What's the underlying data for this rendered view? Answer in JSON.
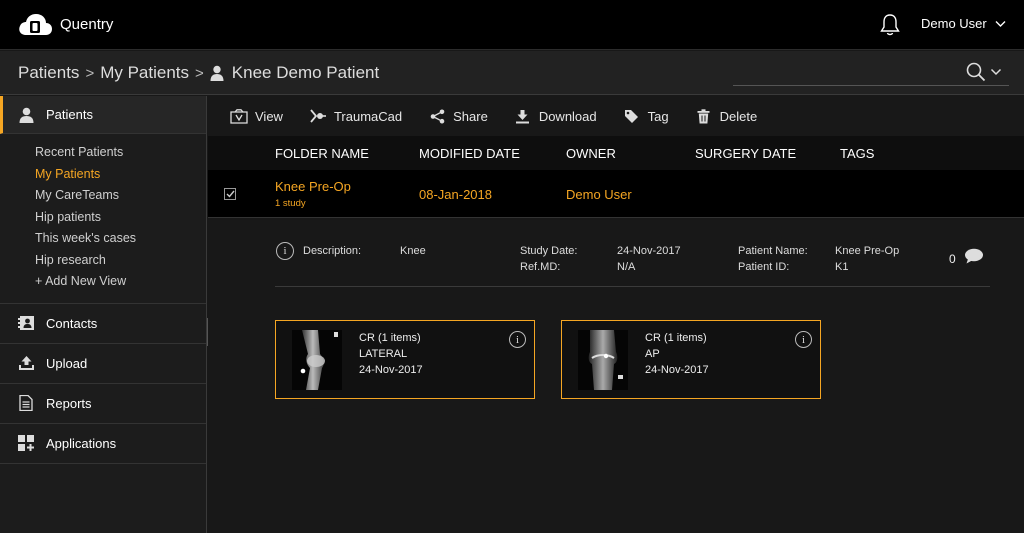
{
  "app": {
    "title": "Quentry"
  },
  "user": {
    "name": "Demo User"
  },
  "breadcrumb": {
    "items": [
      "Patients",
      "My Patients"
    ],
    "current": "Knee Demo Patient"
  },
  "sidebar": {
    "patients_label": "Patients",
    "sub_items": [
      "Recent Patients",
      "My Patients",
      "My CareTeams",
      "Hip patients",
      "This week's cases",
      "Hip research",
      "+ Add New View"
    ],
    "selected_sub": "My Patients",
    "items": [
      {
        "label": "Contacts",
        "icon": "contacts-icon"
      },
      {
        "label": "Upload",
        "icon": "upload-icon"
      },
      {
        "label": "Reports",
        "icon": "reports-icon"
      },
      {
        "label": "Applications",
        "icon": "applications-icon"
      }
    ]
  },
  "toolbar": {
    "view": "View",
    "traumacad": "TraumaCad",
    "share": "Share",
    "download": "Download",
    "tag": "Tag",
    "delete": "Delete"
  },
  "table": {
    "columns": [
      "FOLDER NAME",
      "MODIFIED DATE",
      "OWNER",
      "SURGERY DATE",
      "TAGS"
    ],
    "rows": [
      {
        "folder_name": "Knee Pre-Op",
        "sub": "1 study",
        "modified": "08-Jan-2018",
        "owner": "Demo User",
        "surgery_date": "",
        "tags": "",
        "checked": true
      }
    ]
  },
  "details": {
    "description_label": "Description:",
    "description": "Knee",
    "study_date_label": "Study Date:",
    "study_date": "24-Nov-2017",
    "ref_md_label": "Ref.MD:",
    "ref_md": "N/A",
    "patient_name_label": "Patient Name:",
    "patient_name": "Knee Pre-Op",
    "patient_id_label": "Patient ID:",
    "patient_id": "K1",
    "comments": "0"
  },
  "studies": [
    {
      "type": "CR (1 items)",
      "view": "LATERAL",
      "date": "24-Nov-2017"
    },
    {
      "type": "CR (1 items)",
      "view": "AP",
      "date": "24-Nov-2017"
    }
  ],
  "colors": {
    "accent": "#f5a623",
    "background": "#181818",
    "header": "#000000"
  }
}
